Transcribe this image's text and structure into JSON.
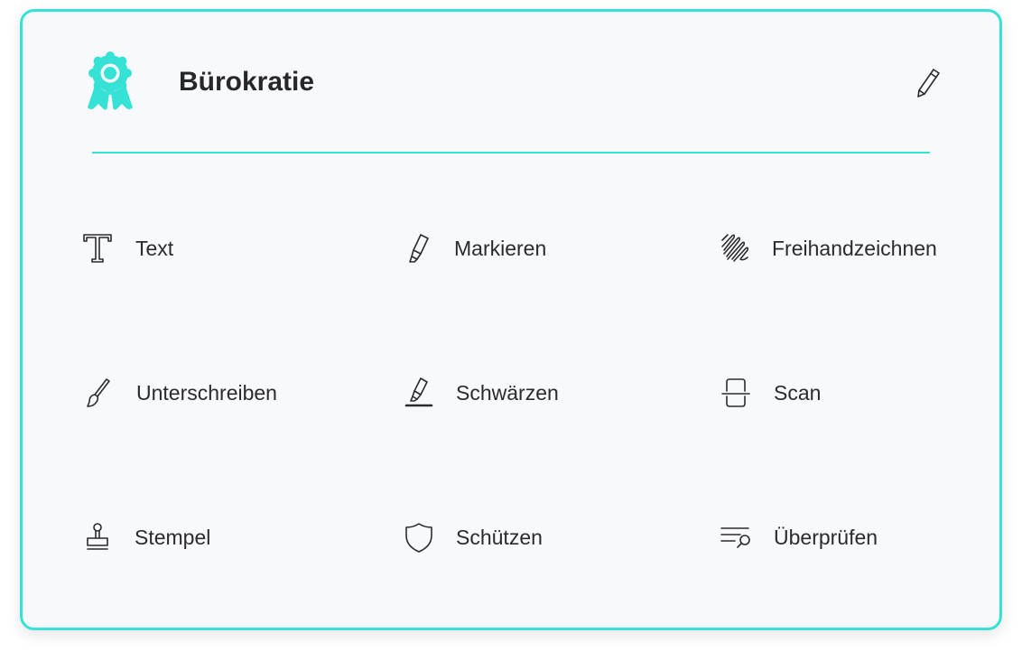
{
  "card": {
    "title": "Bürokratie",
    "header_icon": "award-rosette-icon",
    "edit_icon": "pencil-icon",
    "accent_color": "#36e2d6"
  },
  "tools": [
    {
      "id": "text",
      "label": "Text",
      "icon": "text-serif-t-icon"
    },
    {
      "id": "markieren",
      "label": "Markieren",
      "icon": "highlighter-icon"
    },
    {
      "id": "freihand",
      "label": "Freihandzeichnen",
      "icon": "freehand-scribble-icon"
    },
    {
      "id": "unterschreiben",
      "label": "Unterschreiben",
      "icon": "brush-icon"
    },
    {
      "id": "schwaerzen",
      "label": "Schwärzen",
      "icon": "redact-marker-icon"
    },
    {
      "id": "scan",
      "label": "Scan",
      "icon": "scan-frame-icon"
    },
    {
      "id": "stempel",
      "label": "Stempel",
      "icon": "stamp-icon"
    },
    {
      "id": "schuetzen",
      "label": "Schützen",
      "icon": "shield-icon"
    },
    {
      "id": "ueberpruefen",
      "label": "Überprüfen",
      "icon": "review-search-icon"
    }
  ]
}
